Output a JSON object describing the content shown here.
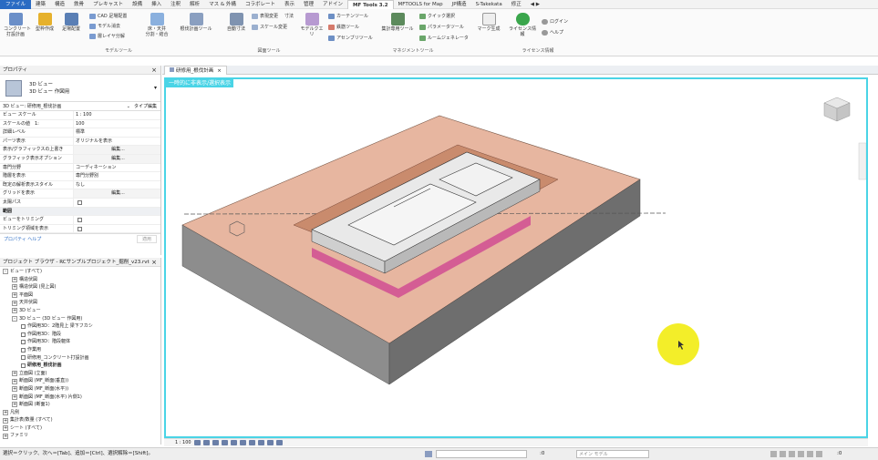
{
  "ribbon_tabs": [
    "ファイル",
    "建築",
    "構造",
    "鉄骨",
    "プレキャスト",
    "設備",
    "挿入",
    "注釈",
    "解析",
    "マス & 外構",
    "コラボレート",
    "表示",
    "管理",
    "アドイン",
    "MF Tools 3.2",
    "MFTOOLS for Map",
    "JP構造",
    "S-Takekata",
    "修正",
    "◀ ▶"
  ],
  "ribbon": {
    "btn_concrete": "コンクリート\n打設計画",
    "btn_type": "型枠作成",
    "btn_footing": "足場配置",
    "cad_place": "CAD 足場配置",
    "model_delete": "モデル消去",
    "layer_split": "層レイヤ分解",
    "btn_beam": "床・天井\n分割・結合",
    "btn_formwork": "根伐計画ツール",
    "btn_auto": "自動寸法",
    "btn_drawing": "表現変更",
    "dim_note": "寸法",
    "scale_change": "スケール変更",
    "btn_model": "モデルクエリ",
    "curtain_tool": "カーテンツール",
    "rebar_tool": "鉄筋ツール",
    "assembly_tool": "アセンブリツール",
    "btn_manage": "集計専用ツール",
    "quick_select": "クイック選択",
    "param_tool": "パラメータツール",
    "room_gen": "ルームジェネレータ",
    "btn_mark": "マーク生成",
    "btn_license": "ライセンス情報",
    "login": "ログイン",
    "help": "ヘルプ",
    "group_model": "モデルツール",
    "group_drawing": "図面ツール",
    "group_manage": "マネジメントツール",
    "group_license": "ライセンス情報"
  },
  "properties": {
    "title": "プロパティ",
    "type_name1": "3D ビュー",
    "type_name2": "3D ビュー 作図用",
    "selector": "3D ビュー: 研修用_根伐計画",
    "edit_type": "タイプ編集",
    "rows": [
      {
        "k": "ビュー スケール",
        "v": "1 : 100"
      },
      {
        "k": "スケールの値　1:",
        "v": "100"
      },
      {
        "k": "詳細レベル",
        "v": "標準"
      },
      {
        "k": "パーツ表示",
        "v": "オリジナルを表示"
      },
      {
        "k": "表示/グラフィックスの上書き",
        "v": "編集..."
      },
      {
        "k": "グラフィック表示オプション",
        "v": "編集..."
      },
      {
        "k": "専門分野",
        "v": "コーディネーション"
      },
      {
        "k": "階層を表示",
        "v": "専門分野別"
      },
      {
        "k": "既定の解析表示スタイル",
        "v": "なし"
      },
      {
        "k": "グリッドを表示",
        "v": "編集..."
      },
      {
        "k": "太陽パス",
        "v": ""
      }
    ],
    "section_extent": "範囲",
    "rows2": [
      {
        "k": "ビューをトリミング",
        "v": ""
      },
      {
        "k": "トリミング領域を表示",
        "v": ""
      }
    ],
    "help_link": "プロパティ ヘルプ",
    "apply": "適用"
  },
  "browser": {
    "title": "プロジェクト ブラウザ - RCサンプルプロジェクト_掘削_v23.rvt",
    "nodes": [
      {
        "label": "ビュー (すべて)",
        "lvl": 0,
        "exp": "-"
      },
      {
        "label": "構造伏図",
        "lvl": 1,
        "exp": "+"
      },
      {
        "label": "構造伏図 (見上図)",
        "lvl": 1,
        "exp": "+"
      },
      {
        "label": "平面図",
        "lvl": 1,
        "exp": "+"
      },
      {
        "label": "天井伏図",
        "lvl": 1,
        "exp": "+"
      },
      {
        "label": "3D ビュー",
        "lvl": 1,
        "exp": "+"
      },
      {
        "label": "3D ビュー (3D ビュー 作図用)",
        "lvl": 1,
        "exp": "-"
      },
      {
        "label": "作図用3D：2階見上 梁下フカシ",
        "lvl": 2,
        "exp": ""
      },
      {
        "label": "作図用3D：階段",
        "lvl": 2,
        "exp": ""
      },
      {
        "label": "作図用3D：階段躯体",
        "lvl": 2,
        "exp": ""
      },
      {
        "label": "作業用",
        "lvl": 2,
        "exp": ""
      },
      {
        "label": "研修用_コンクリート打設計画",
        "lvl": 2,
        "exp": ""
      },
      {
        "label": "研修用_根伐計画",
        "lvl": 2,
        "exp": "",
        "bold": true
      },
      {
        "label": "立面図 (立面)",
        "lvl": 1,
        "exp": "+"
      },
      {
        "label": "断面図 (MF_断面(垂直))",
        "lvl": 1,
        "exp": "+"
      },
      {
        "label": "断面図 (MF_断面(水平))",
        "lvl": 1,
        "exp": "+"
      },
      {
        "label": "断面図 (MF_断面(水平) 片側1)",
        "lvl": 1,
        "exp": "+"
      },
      {
        "label": "断面図 (断面1)",
        "lvl": 1,
        "exp": "+"
      },
      {
        "label": "凡例",
        "lvl": 0,
        "exp": "+"
      },
      {
        "label": "集計表/数量 (すべて)",
        "lvl": 0,
        "exp": "+"
      },
      {
        "label": "シート (すべて)",
        "lvl": 0,
        "exp": "+"
      },
      {
        "label": "ファミリ",
        "lvl": 0,
        "exp": "+"
      }
    ]
  },
  "view": {
    "tab_label": "研修用_根伐計画",
    "temp_banner": "一時的に非表示/選択表示",
    "scale": "1 : 100"
  },
  "status": {
    "hint": "選択＝クリック、次へ＝[Tab]、追加＝[Ctrl]、選択解除＝[Shift]。",
    "zero": ":0",
    "main_model": "メイン モデル",
    "filter_count": ":0"
  },
  "colors": {
    "accent": "#4ad4e6",
    "file_tab": "#2a6bc3",
    "ground_top": "#e7b6a0",
    "ground_side": "#8a8a8a",
    "pit": "#c98b6d",
    "cursor_hl": "#f3ee29"
  }
}
